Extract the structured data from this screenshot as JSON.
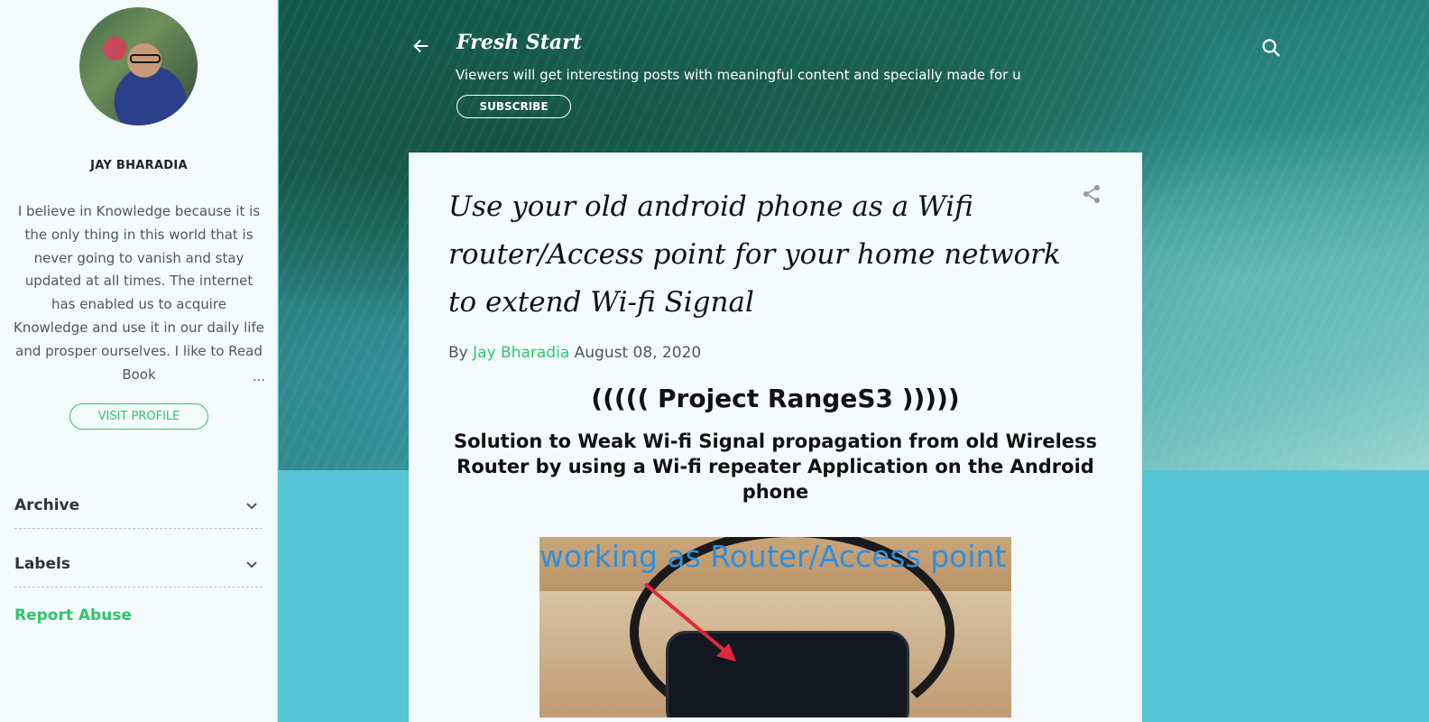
{
  "sidebar": {
    "profile_name": "JAY BHARADIA",
    "bio": "I believe in Knowledge because it is the only thing in this world that is never going to vanish and stay updated at all times. The internet has enabled us to acquire Knowledge and use it in our daily life and prosper ourselves. I like to Read Book",
    "bio_ellipsis": "…",
    "visit_profile_label": "VISIT PROFILE",
    "sections": [
      {
        "label": "Archive"
      },
      {
        "label": "Labels"
      }
    ],
    "report_abuse_label": "Report Abuse"
  },
  "header": {
    "title": "Fresh Start",
    "description": "Viewers will get interesting posts with meaningful content and specially made for u",
    "subscribe_label": "SUBSCRIBE"
  },
  "post": {
    "title": "Use your old android phone as a Wifi router/Access point for your home network to extend Wi-fi Signal",
    "by_label": "By",
    "author": "Jay Bharadia",
    "date": "August 08, 2020",
    "heading1": "((((( Project RangeS3 )))))",
    "heading2": "Solution to Weak Wi-fi Signal propagation from old Wireless Router by using a Wi-fi repeater Application on the Android phone",
    "image_caption": "working as Router/Access point"
  },
  "colors": {
    "accent_green": "#2fc56f",
    "page_bg": "#56c5d5",
    "card_bg": "#f4fbfd"
  }
}
